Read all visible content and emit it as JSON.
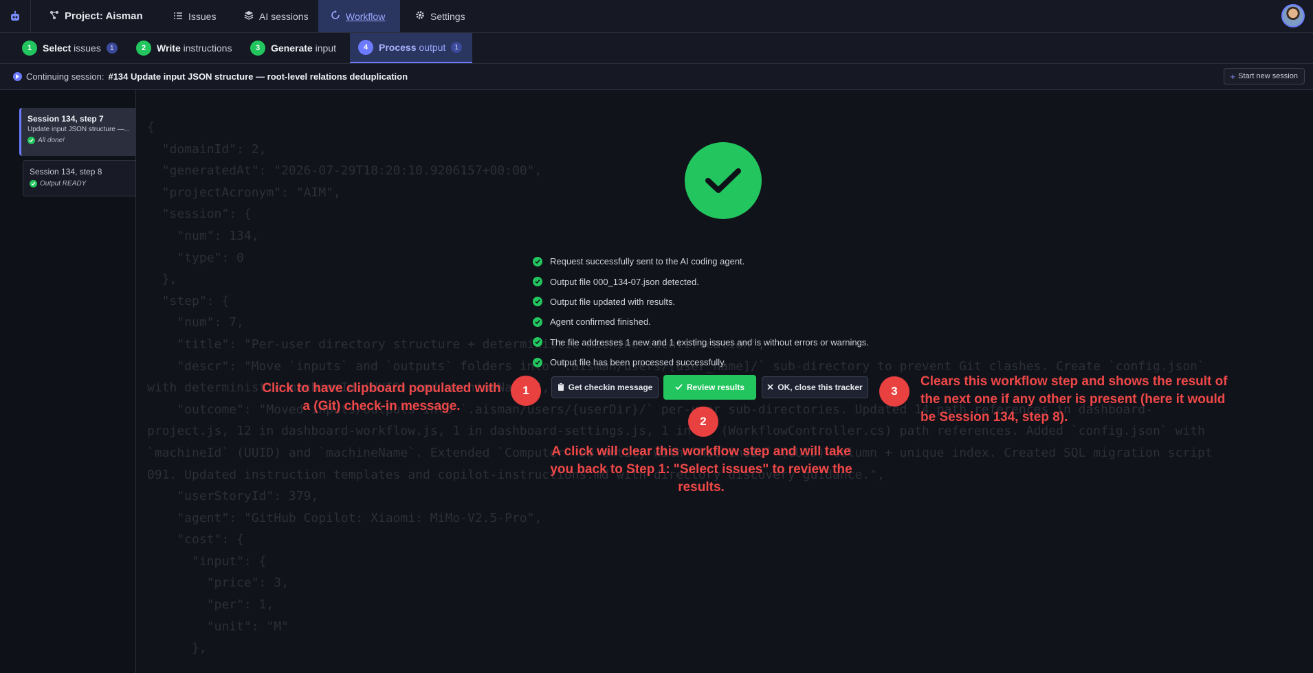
{
  "topnav": {
    "project": "Project: Aisman",
    "issues": "Issues",
    "ai_sessions": "AI sessions",
    "workflow": "Workflow",
    "settings": "Settings"
  },
  "steps": [
    {
      "num": "1",
      "bold": "Select",
      "rest": "issues",
      "count": "1"
    },
    {
      "num": "2",
      "bold": "Write",
      "rest": "instructions"
    },
    {
      "num": "3",
      "bold": "Generate",
      "rest": "input"
    },
    {
      "num": "4",
      "bold": "Process",
      "rest": "output",
      "count": "1"
    }
  ],
  "session_bar": {
    "prefix": "Continuing session:",
    "title": "#134 Update input JSON structure — root-level relations deduplication",
    "new_button": "Start new session"
  },
  "sidebar": {
    "items": [
      {
        "title": "Session 134, step 7",
        "desc": "Update input JSON structure —...",
        "status": "All done!"
      },
      {
        "title": "Session 134, step 8",
        "status": "Output READY"
      }
    ]
  },
  "code_lines": [
    "{",
    "  \"domainId\": 2,",
    "  \"generatedAt\": \"2026-07-29T18:20:10.9206157+00:00\",",
    "  \"projectAcronym\": \"AIM\",",
    "  \"session\": {",
    "    \"num\": 134,",
    "    \"type\": 0",
    "  },",
    "  \"step\": {",
    "    \"num\": 7,",
    "    \"title\": \"Per-user directory structure + deterministic machine identification\",",
    "    \"descr\": \"Move `inputs` and `outputs` folders into `.aisman/users/[user_name]/` sub-directory to prevent Git clashes. Create `config.json`",
    "with deterministic machineId (UUID) and machineName.\",",
    "    \"outcome\": \"Moved inputs/outputs into `.aisman/users/{userDir}/` per-user sub-directories. Updated 14 path references in dashboard-",
    "project.js, 12 in dashboard-workflow.js, 1 in dashboard-settings.js, 1 in C# (WorkflowController.cs) path references. Added `config.json` with",
    "`machineId` (UUID) and `machineName`. Extended `Computer` DB entity with `MachineId` (GUID) column + unique index. Created SQL migration script",
    "091. Updated instruction templates and copilot-instructions.md with directory discovery guidance.\",",
    "    \"userStoryId\": 379,",
    "    \"agent\": \"GitHub Copilot: Xiaomi: MiMo-V2.5-Pro\",",
    "    \"cost\": {",
    "      \"input\": {",
    "        \"price\": 3,",
    "        \"per\": 1,",
    "        \"unit\": \"M\"",
    "      },"
  ],
  "status_lines": [
    "Request successfully sent to the AI coding agent.",
    "Output file 000_134-07.json detected.",
    "Output file updated with results.",
    "Agent confirmed finished.",
    "The file addresses 1 new and 1 existing issues and is without errors or warnings.",
    "Output file has been processed successfully."
  ],
  "buttons": {
    "checkin": "Get checkin message",
    "review": "Review results",
    "close": "OK, close this tracker"
  },
  "annotations": {
    "markers": [
      "1",
      "2",
      "3"
    ],
    "note1": "Click to have clipboard populated with a (Git) check-in message.",
    "note2": "A click will clear this workflow step and will take you back to Step 1: \"Select issues\" to review the results.",
    "note3": "Clears this workflow step and shows the result of the next one if any other is present (here it would be Session 134, step 8)."
  },
  "colors": {
    "accent": "#6c7bff",
    "success": "#22c55e",
    "annotation": "#f04848"
  },
  "icons": [
    "app-logo-icon",
    "project-icon",
    "issues-icon",
    "ai-sessions-icon",
    "workflow-icon",
    "settings-icon",
    "play-icon",
    "plus-icon",
    "check-icon",
    "clipboard-icon",
    "close-icon"
  ]
}
